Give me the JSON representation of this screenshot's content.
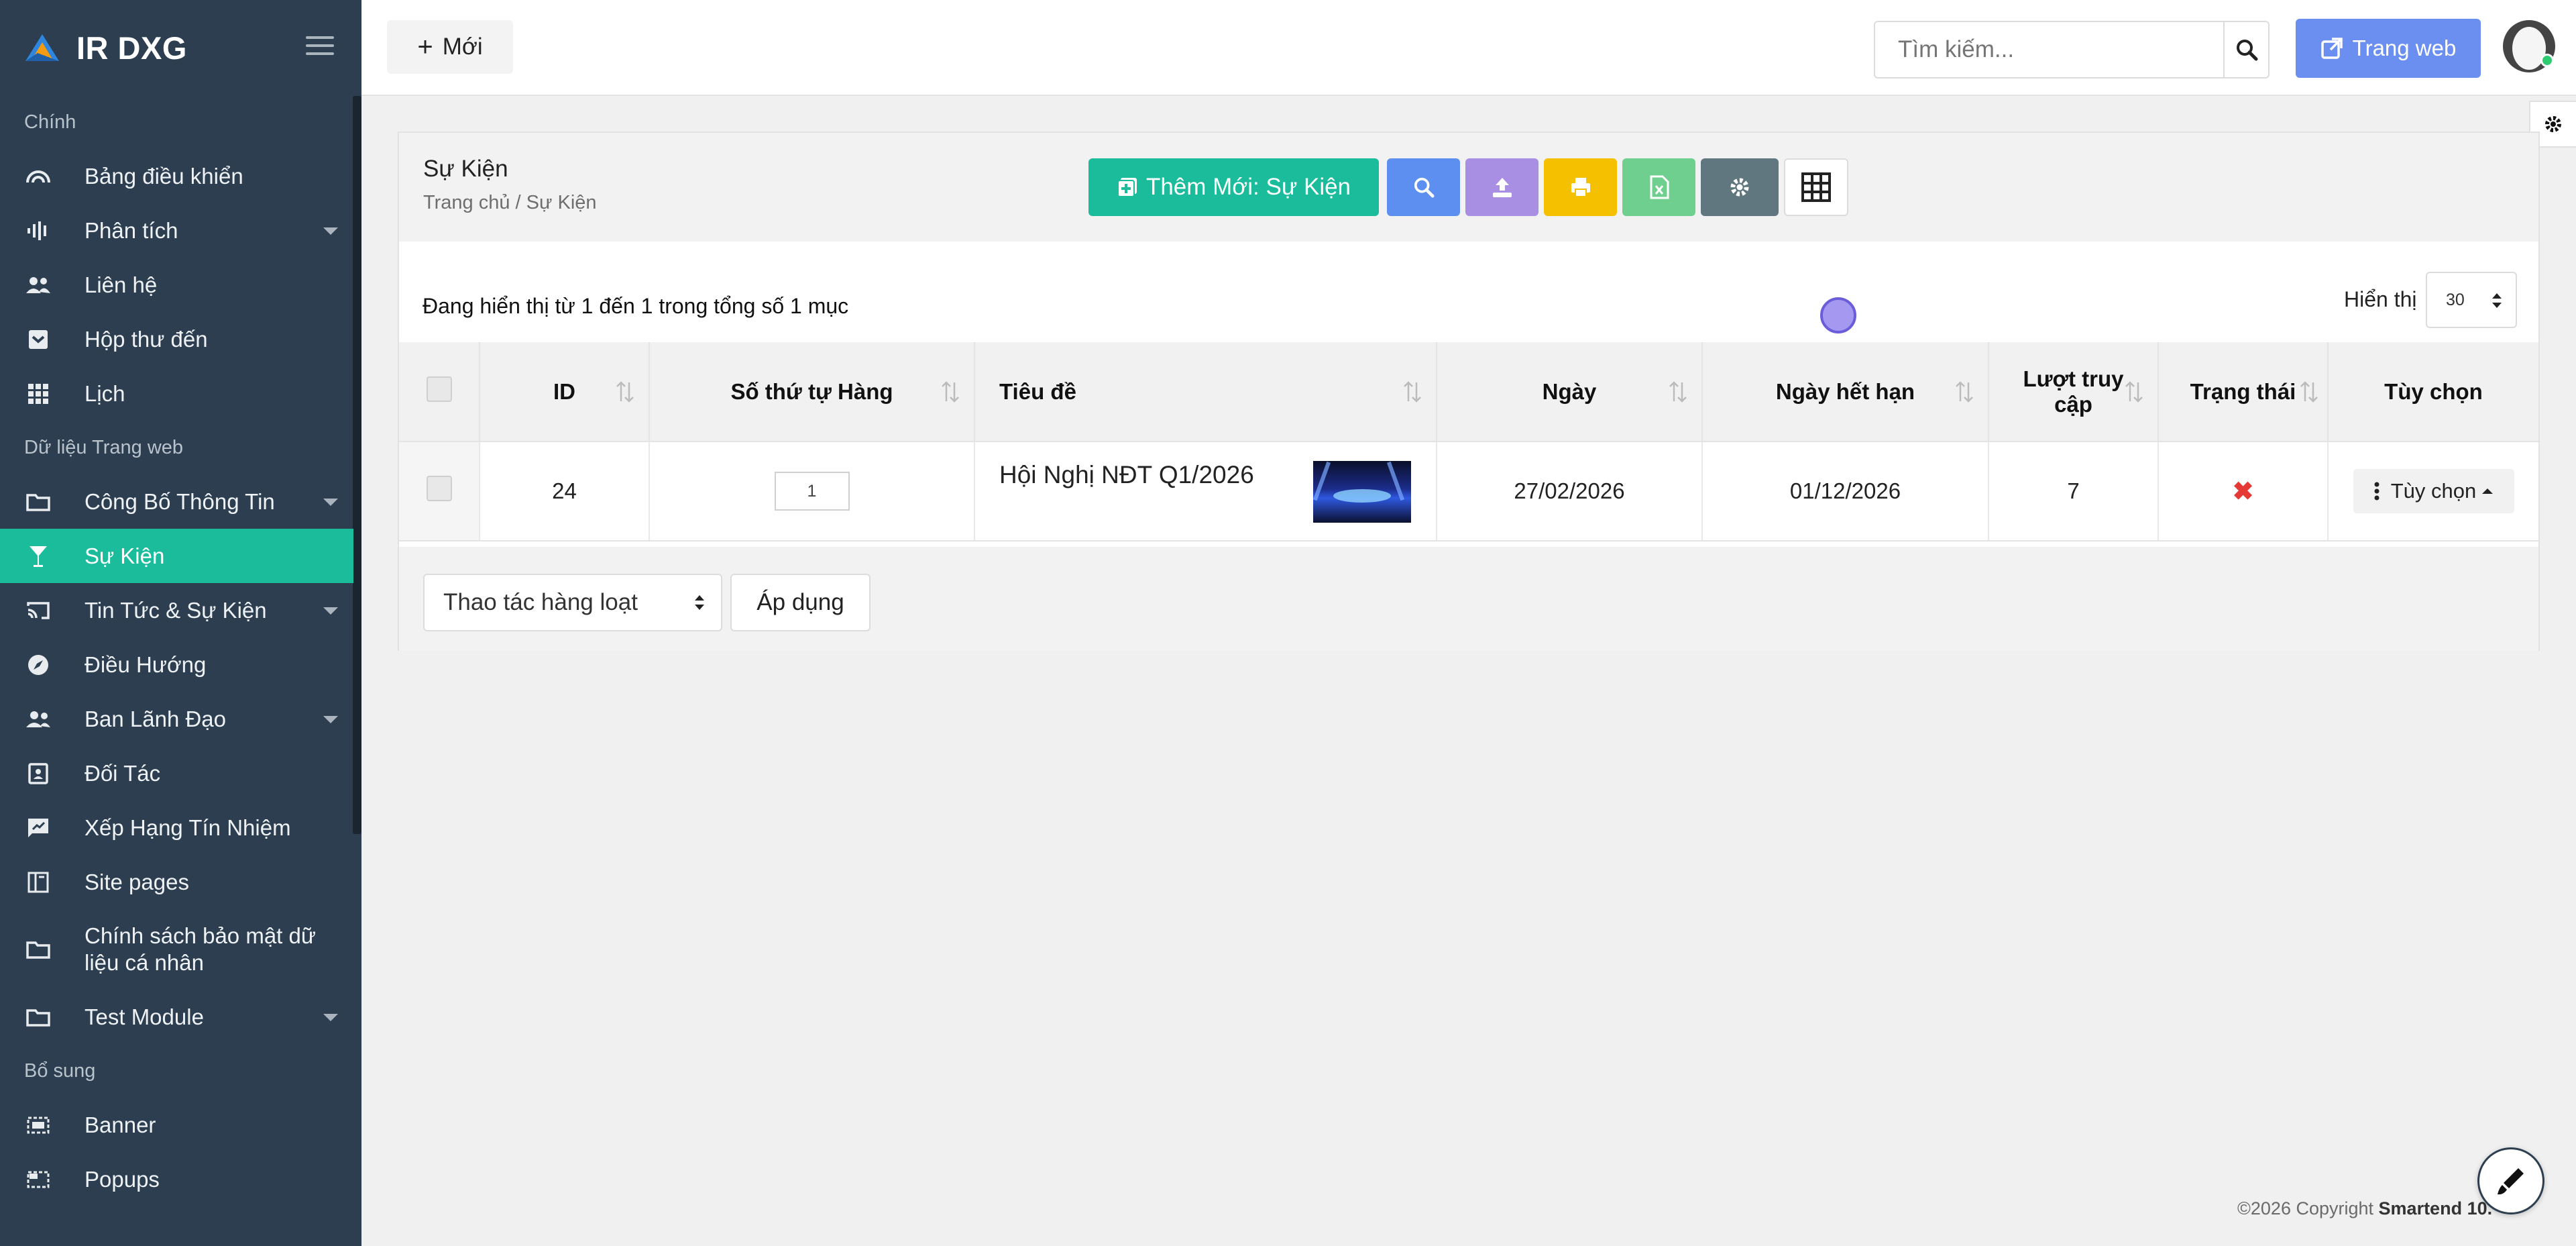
{
  "brand": {
    "name": "IR DXG"
  },
  "colors": {
    "sidebar": "#2c3e50",
    "accent": "#1abc9c",
    "web_button": "#6a8ff0",
    "search_tool": "#5d8ff0",
    "upload_tool": "#a98fe3",
    "print_tool": "#f5c000",
    "excel_tool": "#6fcf8f",
    "settings_tool": "#60777f",
    "status_inactive": "#e53935"
  },
  "sidebar": {
    "sections": [
      {
        "title": "Chính",
        "items": [
          {
            "label": "Bảng điều khiển",
            "icon": "dashboard-icon",
            "has_submenu": false
          },
          {
            "label": "Phân tích",
            "icon": "analytics-icon",
            "has_submenu": true
          },
          {
            "label": "Liên hệ",
            "icon": "contacts-icon",
            "has_submenu": false
          },
          {
            "label": "Hộp thư đến",
            "icon": "inbox-icon",
            "has_submenu": false
          },
          {
            "label": "Lịch",
            "icon": "calendar-grid-icon",
            "has_submenu": false
          }
        ]
      },
      {
        "title": "Dữ liệu Trang web",
        "items": [
          {
            "label": "Công Bố Thông Tin",
            "icon": "folder-icon",
            "has_submenu": true
          },
          {
            "label": "Sự Kiện",
            "icon": "glass-icon",
            "has_submenu": false,
            "active": true
          },
          {
            "label": "Tin Tức & Sự Kiện",
            "icon": "cast-icon",
            "has_submenu": true
          },
          {
            "label": "Điều Hướng",
            "icon": "compass-icon",
            "has_submenu": false
          },
          {
            "label": "Ban Lãnh Đạo",
            "icon": "people-icon",
            "has_submenu": true
          },
          {
            "label": "Đối Tác",
            "icon": "contact-card-icon",
            "has_submenu": false
          },
          {
            "label": "Xếp Hạng Tín Nhiệm",
            "icon": "rating-icon",
            "has_submenu": false
          },
          {
            "label": "Site pages",
            "icon": "pages-icon",
            "has_submenu": false
          },
          {
            "label": "Chính sách bảo mật dữ liệu cá nhân",
            "icon": "folder-icon",
            "has_submenu": false
          },
          {
            "label": "Test Module",
            "icon": "folder-icon",
            "has_submenu": true
          }
        ]
      },
      {
        "title": "Bổ sung",
        "items": [
          {
            "label": "Banner",
            "icon": "banner-icon",
            "has_submenu": false
          },
          {
            "label": "Popups",
            "icon": "popup-icon",
            "has_submenu": false
          }
        ]
      }
    ]
  },
  "topbar": {
    "new_label": "Mới",
    "search_placeholder": "Tìm kiếm...",
    "web_label": "Trang web"
  },
  "page": {
    "title": "Sự Kiện",
    "breadcrumb": "Trang chủ / Sự Kiện",
    "add_label": "Thêm Mới: Sự Kiện"
  },
  "table": {
    "summary": "Đang hiển thị từ 1 đến 1 trong tổng số 1 mục",
    "per_page_label": "Hiển thị",
    "per_page_value": "30",
    "headers": {
      "id": "ID",
      "order": "Số thứ tự Hàng",
      "title": "Tiêu đề",
      "date": "Ngày",
      "expiry": "Ngày hết hạn",
      "views_line1": "Lượt truy",
      "views_line2": "cập",
      "status": "Trạng thái",
      "options": "Tùy chọn"
    },
    "rows": [
      {
        "id": "24",
        "order": "1",
        "title": "Hội Nghị NĐT Q1/2026",
        "date": "27/02/2026",
        "expiry": "01/12/2026",
        "views": "7",
        "status": "inactive",
        "status_symbol": "✖",
        "options_label": "Tùy chọn"
      }
    ]
  },
  "bulk": {
    "select_label": "Thao tác hàng loạt",
    "apply_label": "Áp dụng"
  },
  "footer": {
    "copyright": "©2026 Copyright",
    "company": "Smartend 10."
  }
}
